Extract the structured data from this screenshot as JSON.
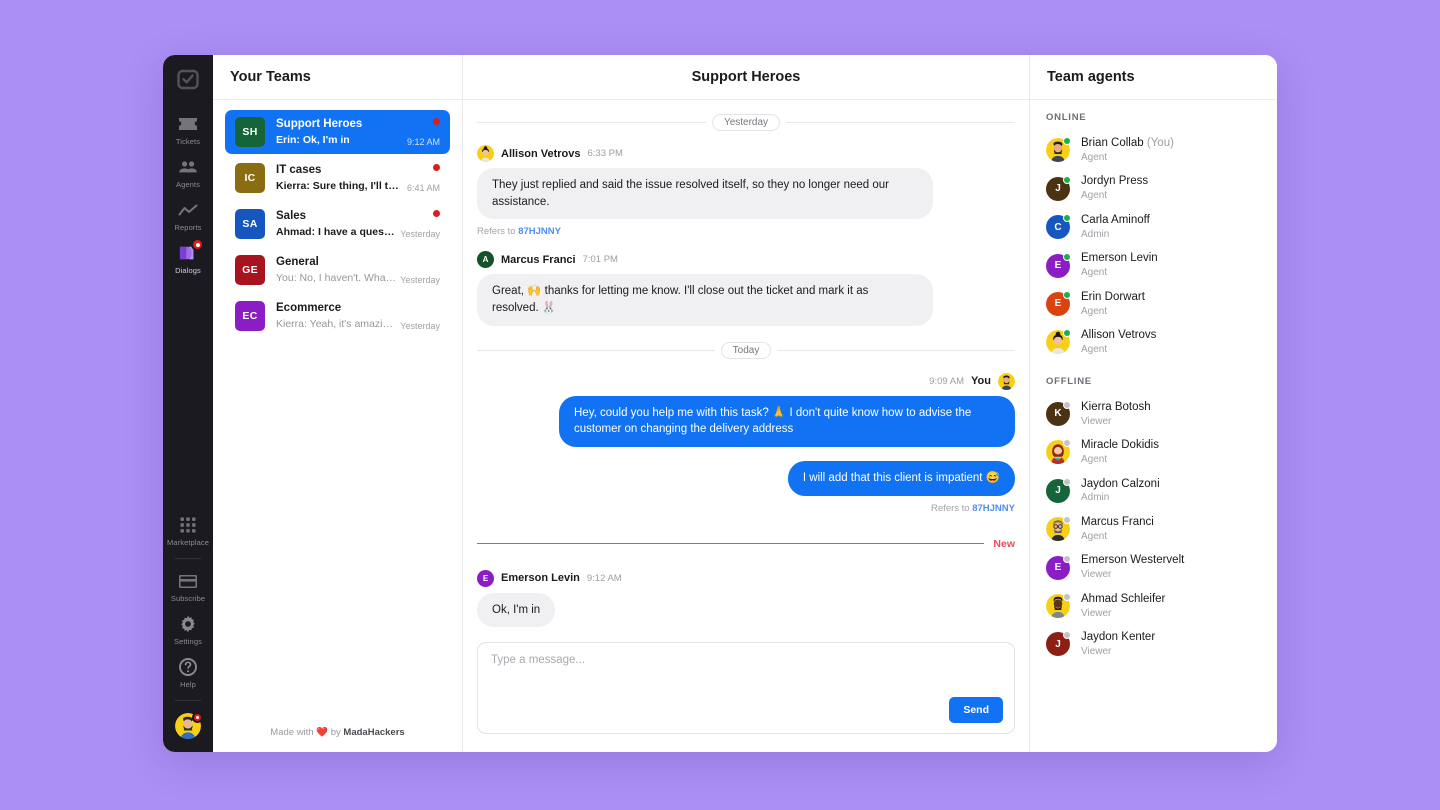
{
  "rail": {
    "logo_icon": "checkbox-logo-icon",
    "items": [
      {
        "label": "Tickets",
        "icon": "ticket-icon",
        "active": false,
        "badge": false
      },
      {
        "label": "Agents",
        "icon": "people-icon",
        "active": false,
        "badge": false
      },
      {
        "label": "Reports",
        "icon": "chart-line-icon",
        "active": false,
        "badge": false
      },
      {
        "label": "Dialogs",
        "icon": "dialogs-icon",
        "active": true,
        "badge": true
      }
    ],
    "bottom_items": [
      {
        "label": "Marketplace",
        "icon": "grid-dots-icon"
      },
      {
        "label": "Subscribe",
        "icon": "card-icon"
      },
      {
        "label": "Settings",
        "icon": "gear-icon"
      },
      {
        "label": "Help",
        "icon": "question-circle-icon"
      }
    ],
    "avatar_name": "user-avatar"
  },
  "teams_panel": {
    "title": "Your Teams",
    "footer_prefix": "Made with",
    "footer_heart": "❤️",
    "footer_by": "by",
    "footer_brand": "MadaHackers",
    "teams": [
      {
        "initials": "SH",
        "color": "#16643a",
        "name": "Support Heroes",
        "preview": "Erin: Ok, I'm in",
        "time": "9:12 AM",
        "unread": true,
        "selected": true,
        "bold_preview": true
      },
      {
        "initials": "IC",
        "color": "#8a6d10",
        "name": "IT cases",
        "preview": "Kierra: Sure thing, I'll take...",
        "time": "6:41 AM",
        "unread": true,
        "selected": false,
        "bold_preview": true
      },
      {
        "initials": "SA",
        "color": "#1556c0",
        "name": "Sales",
        "preview": "Ahmad: I have a questio...",
        "time": "Yesterday",
        "unread": true,
        "selected": false,
        "bold_preview": true
      },
      {
        "initials": "GE",
        "color": "#a81320",
        "name": "General",
        "preview": "You: No, I haven't. What's...",
        "time": "Yesterday",
        "unread": false,
        "selected": false,
        "bold_preview": false
      },
      {
        "initials": "EC",
        "color": "#8a1ec4",
        "name": "Ecommerce",
        "preview": "Kierra: Yeah, it's amazin...",
        "time": "Yesterday",
        "unread": false,
        "selected": false,
        "bold_preview": false
      }
    ]
  },
  "chat": {
    "title": "Support Heroes",
    "separator_yesterday": "Yesterday",
    "separator_today": "Today",
    "new_divider_label": "New",
    "messages": [
      {
        "direction": "in",
        "author": "Allison Vetrovs",
        "time": "6:33 PM",
        "avatar_kind": "photo-woman-bun",
        "avatar_color": "#f7cf16",
        "avatar_initial": "A",
        "text": "They just replied and said the issue resolved itself, so they no longer need our assistance.",
        "refers_label": "Refers to",
        "refers_code": "87HJNNY"
      },
      {
        "direction": "in",
        "author": "Marcus Franci",
        "time": "7:01 PM",
        "avatar_kind": "initial",
        "avatar_color": "#14532a",
        "avatar_initial": "A",
        "text": "Great, 🙌 thanks for letting me know. I'll close out the ticket and mark it as resolved. 🐰",
        "refers_label": "",
        "refers_code": ""
      },
      {
        "direction": "out",
        "author": "You",
        "time": "9:09 AM",
        "avatar_kind": "photo-man",
        "avatar_color": "#f7cf16",
        "avatar_initial": "B",
        "text": "Hey, could you help me with this task? 🙏 I don't quite know how to advise the customer on changing the delivery address",
        "refers_label": "",
        "refers_code": ""
      },
      {
        "direction": "out",
        "author": "",
        "time": "",
        "avatar_kind": "none",
        "avatar_color": "",
        "avatar_initial": "",
        "text": "I will add that this client is impatient 😅",
        "refers_label": "Refers to",
        "refers_code": "87HJNNY"
      },
      {
        "direction": "in",
        "author": "Emerson Levin",
        "time": "9:12 AM",
        "avatar_kind": "initial",
        "avatar_color": "#8a1ec4",
        "avatar_initial": "E",
        "text": "Ok, I'm in",
        "refers_label": "",
        "refers_code": ""
      }
    ],
    "composer": {
      "placeholder": "Type a message...",
      "value": "",
      "send_label": "Send"
    }
  },
  "agents_panel": {
    "title": "Team agents",
    "groups": [
      {
        "label": "ONLINE",
        "status": "online",
        "agents": [
          {
            "name": "Brian Collab",
            "suffix": "(You)",
            "role": "Agent",
            "avatar_kind": "photo-man-beard",
            "color": "#f7cf16",
            "initial": "B"
          },
          {
            "name": "Jordyn Press",
            "suffix": "",
            "role": "Agent",
            "avatar_kind": "initial",
            "color": "#4a3212",
            "initial": "J"
          },
          {
            "name": "Carla Aminoff",
            "suffix": "",
            "role": "Admin",
            "avatar_kind": "initial",
            "color": "#1556c0",
            "initial": "C"
          },
          {
            "name": "Emerson Levin",
            "suffix": "",
            "role": "Agent",
            "avatar_kind": "initial",
            "color": "#8a1ec4",
            "initial": "E"
          },
          {
            "name": "Erin Dorwart",
            "suffix": "",
            "role": "Agent",
            "avatar_kind": "initial",
            "color": "#da4311",
            "initial": "E"
          },
          {
            "name": "Allison Vetrovs",
            "suffix": "",
            "role": "Agent",
            "avatar_kind": "photo-woman-bun",
            "color": "#f7cf16",
            "initial": "A"
          }
        ]
      },
      {
        "label": "OFFLINE",
        "status": "offline",
        "agents": [
          {
            "name": "Kierra Botosh",
            "suffix": "",
            "role": "Viewer",
            "avatar_kind": "initial",
            "color": "#4a3212",
            "initial": "K"
          },
          {
            "name": "Miracle Dokidis",
            "suffix": "",
            "role": "Agent",
            "avatar_kind": "photo-woman-red",
            "color": "#f7cf16",
            "initial": "M"
          },
          {
            "name": "Jaydon Calzoni",
            "suffix": "",
            "role": "Admin",
            "avatar_kind": "initial",
            "color": "#16643a",
            "initial": "J"
          },
          {
            "name": "Marcus Franci",
            "suffix": "",
            "role": "Agent",
            "avatar_kind": "photo-man-glasses",
            "color": "#f7cf16",
            "initial": "M"
          },
          {
            "name": "Emerson Westervelt",
            "suffix": "",
            "role": "Viewer",
            "avatar_kind": "initial",
            "color": "#8a1ec4",
            "initial": "E"
          },
          {
            "name": "Ahmad Schleifer",
            "suffix": "",
            "role": "Viewer",
            "avatar_kind": "photo-man-dark",
            "color": "#f7cf16",
            "initial": "A"
          },
          {
            "name": "Jaydon Kenter",
            "suffix": "",
            "role": "Viewer",
            "avatar_kind": "initial",
            "color": "#8c1f13",
            "initial": "J"
          }
        ]
      }
    ]
  },
  "colors": {
    "page_background": "#ab8ff5",
    "accent_blue": "#1173f4",
    "unread_red": "#e01b1b",
    "new_red": "#ef4b5c",
    "rail_dark": "#1c1a21"
  }
}
